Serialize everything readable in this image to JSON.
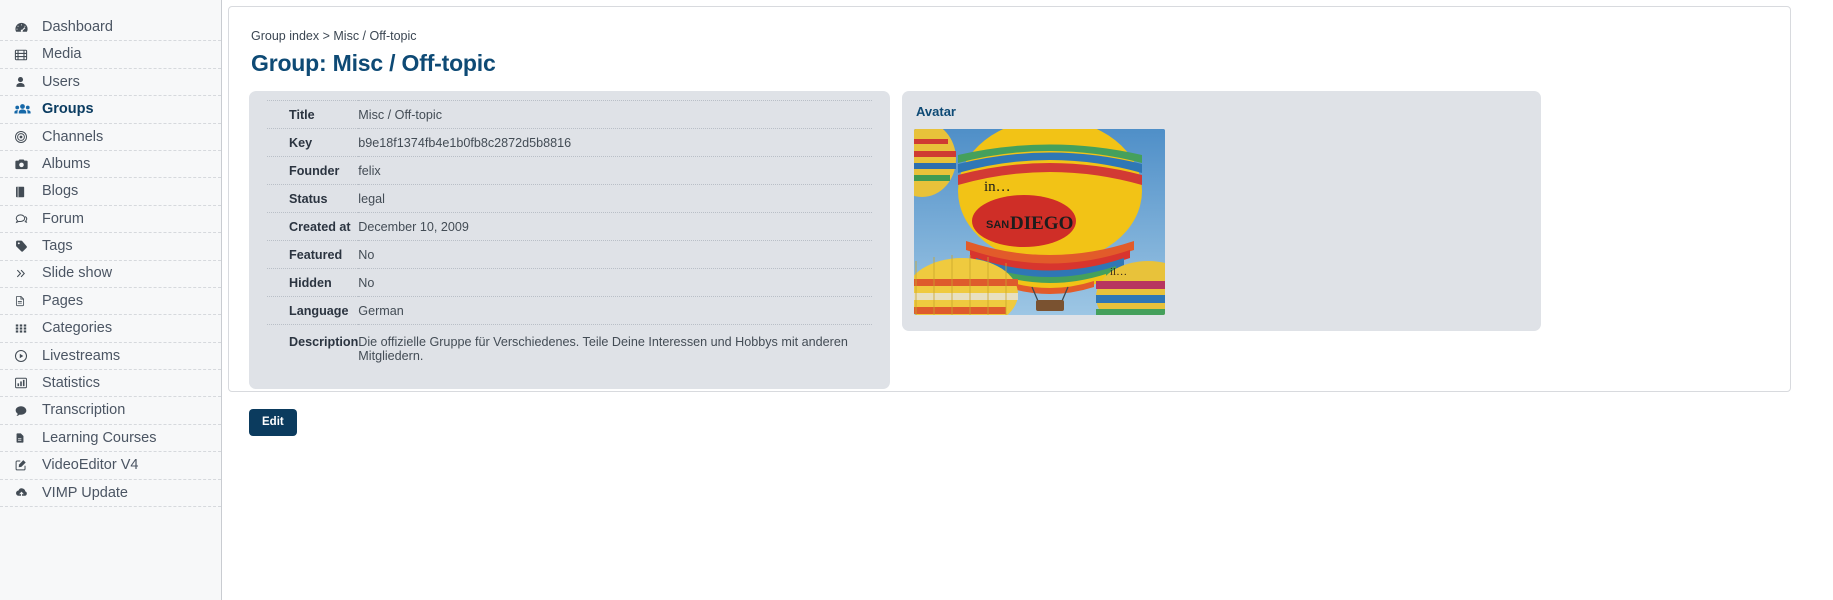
{
  "sidebar": {
    "items": [
      {
        "label": "Dashboard",
        "icon": "dashboard-icon",
        "active": false
      },
      {
        "label": "Media",
        "icon": "film-icon",
        "active": false
      },
      {
        "label": "Users",
        "icon": "user-icon",
        "active": false
      },
      {
        "label": "Groups",
        "icon": "users-group-icon",
        "active": true
      },
      {
        "label": "Channels",
        "icon": "target-icon",
        "active": false
      },
      {
        "label": "Albums",
        "icon": "camera-icon",
        "active": false
      },
      {
        "label": "Blogs",
        "icon": "book-icon",
        "active": false
      },
      {
        "label": "Forum",
        "icon": "comments-icon",
        "active": false
      },
      {
        "label": "Tags",
        "icon": "tag-icon",
        "active": false
      },
      {
        "label": "Slide show",
        "icon": "chevrons-right-icon",
        "active": false
      },
      {
        "label": "Pages",
        "icon": "file-text-icon",
        "active": false
      },
      {
        "label": "Categories",
        "icon": "grid-icon",
        "active": false
      },
      {
        "label": "Livestreams",
        "icon": "play-circle-icon",
        "active": false
      },
      {
        "label": "Statistics",
        "icon": "bar-chart-icon",
        "active": false
      },
      {
        "label": "Transcription",
        "icon": "comment-icon",
        "active": false
      },
      {
        "label": "Learning Courses",
        "icon": "file-lines-icon",
        "active": false
      },
      {
        "label": "VideoEditor V4",
        "icon": "edit-square-icon",
        "active": false
      },
      {
        "label": "VIMP Update",
        "icon": "cloud-upload-icon",
        "active": false
      }
    ]
  },
  "breadcrumb": {
    "root": "Group index",
    "separator": ">",
    "current": "Misc / Off-topic"
  },
  "page": {
    "title": "Group: Misc / Off-topic"
  },
  "details": {
    "rows": [
      {
        "label": "Title",
        "value": "Misc / Off-topic"
      },
      {
        "label": "Key",
        "value": "b9e18f1374fb4e1b0fb8c2872d5b8816"
      },
      {
        "label": "Founder",
        "value": "felix"
      },
      {
        "label": "Status",
        "value": "legal"
      },
      {
        "label": "Created at",
        "value": "December 10, 2009"
      },
      {
        "label": "Featured",
        "value": "No"
      },
      {
        "label": "Hidden",
        "value": "No"
      },
      {
        "label": "Language",
        "value": "German"
      },
      {
        "label": "Description",
        "value": "Die offizielle Gruppe für Verschiedenes. Teile Deine Interessen und Hobbys mit anderen Mitgliedern."
      }
    ]
  },
  "avatar": {
    "title": "Avatar",
    "image_alt": "hot air balloons in... SAN DIEGO",
    "image_text_top": "in...",
    "image_text_main": "SAN DIEGO"
  },
  "actions": {
    "edit_label": "Edit"
  },
  "colors": {
    "accent": "#0e4a75",
    "button": "#0b3b5e",
    "panel": "#dfe2e7",
    "sidebar": "#f7f8f9",
    "text": "#434c55"
  }
}
